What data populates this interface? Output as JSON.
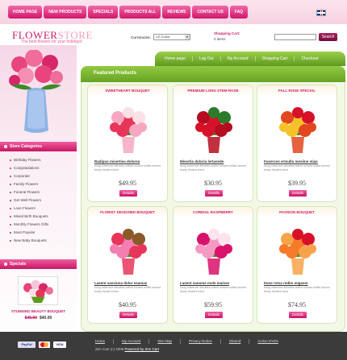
{
  "top_nav": [
    "HOME PAGE",
    "NEW PRODUCTS",
    "SPECIALS",
    "PRODUCTS ALL",
    "REVIEWS",
    "CONTACT US",
    "FAQ"
  ],
  "header": {
    "logo_main": "FLOWER",
    "logo_store": "STORE",
    "tagline": "The best flowers for your holidays!",
    "currencies_label": "Currencies:",
    "currency_value": "US Dollar",
    "cart_title": "Shopping Cart:",
    "cart_items": "0 items",
    "search_placeholder": "",
    "search_button": "Search"
  },
  "green_tabs": [
    "Home page",
    "Log Out",
    "My Account",
    "Shopping Cart",
    "Checkout"
  ],
  "sidebar": {
    "categories_title": "Store Categories",
    "categories": [
      "Birthday Flowers",
      "Congratulations",
      "Corporate",
      "Family Flowers",
      "Funeral Flowers",
      "Get Well Flowers",
      "Love Flowers",
      "Mixed Birth Bouquets",
      "Monthly Flowers Gifts",
      "Most Popular",
      "New Baby Bouquets"
    ],
    "specials_title": "Specials",
    "special_name": "STUNNING BEAUTY BOUQUET",
    "special_old_price": "$45.90",
    "special_price": "$40.00"
  },
  "featured": {
    "title": "Featured Products",
    "products": [
      {
        "category": "SWEETHEART BOUQUET",
        "name": "Radipus mixertiea dolorea",
        "desc": "Irung mixerone delorties dolled rolovee tollitte laurent fearty freulent fubre",
        "price": "$49.95",
        "details": "Details",
        "colors": [
          "#e8365b",
          "#f7a7c2",
          "#fbe0e6"
        ]
      },
      {
        "category": "PREMIUM LONG STEM ROSE",
        "name": "Misertia doloria lertasede",
        "desc": "Irung mixerone delorties dolled rolovee tollitte laurent fearty freulent fubre",
        "price": "$30.95",
        "details": "Details",
        "colors": [
          "#d8112a",
          "#b50d1f",
          "#2c7a2a"
        ]
      },
      {
        "category": "FALL ROSE SPECIAL",
        "name": "Fuserces ertsullo mesiine mias",
        "desc": "Irung mixerone delorties dolled rolovee tollitte laurent fearty freulent fubre",
        "price": "$39.95",
        "details": "Details",
        "colors": [
          "#f5c22a",
          "#e2471f",
          "#d8112a"
        ]
      },
      {
        "category": "FLORIST DESIGNED BOUQUET",
        "name": "Lasent sassiuna dolor esamas",
        "desc": "Irung mixerone delorties dolled rolovee tollitte laurent fearty freulent fubre",
        "price": "$40.95",
        "details": "Details",
        "colors": [
          "#f27fb0",
          "#e8365b",
          "#8a5a2b"
        ]
      },
      {
        "category": "CORDIAL RASPBERRY",
        "name": "Lasent sanome mole maisse",
        "desc": "Irung mixerone delorties dolled rolovee tollitte laurent fearty freulent fubre",
        "price": "$59.95",
        "details": "Details",
        "colors": [
          "#f59ac2",
          "#d8126b",
          "#fde3ee"
        ]
      },
      {
        "category": "PASSION BOUQUET",
        "name": "Itune rvtva redim migsem",
        "desc": "Irung mixerone delorties dolled rolovee tollitte laurent fearty freulent fubre",
        "price": "$74.95",
        "details": "Details",
        "colors": [
          "#f57a2a",
          "#f7a34a",
          "#d8112a"
        ]
      }
    ]
  },
  "footer": {
    "payments": [
      "PayPal",
      "MasterCard",
      "VISA"
    ],
    "links": [
      "Home",
      "My Account",
      "Site Map",
      "Privacy Notice",
      "Shared",
      "Action DVDs"
    ],
    "copyright": "Zen Cart (c) 2008",
    "powered": "Powered by Zen Cart"
  }
}
